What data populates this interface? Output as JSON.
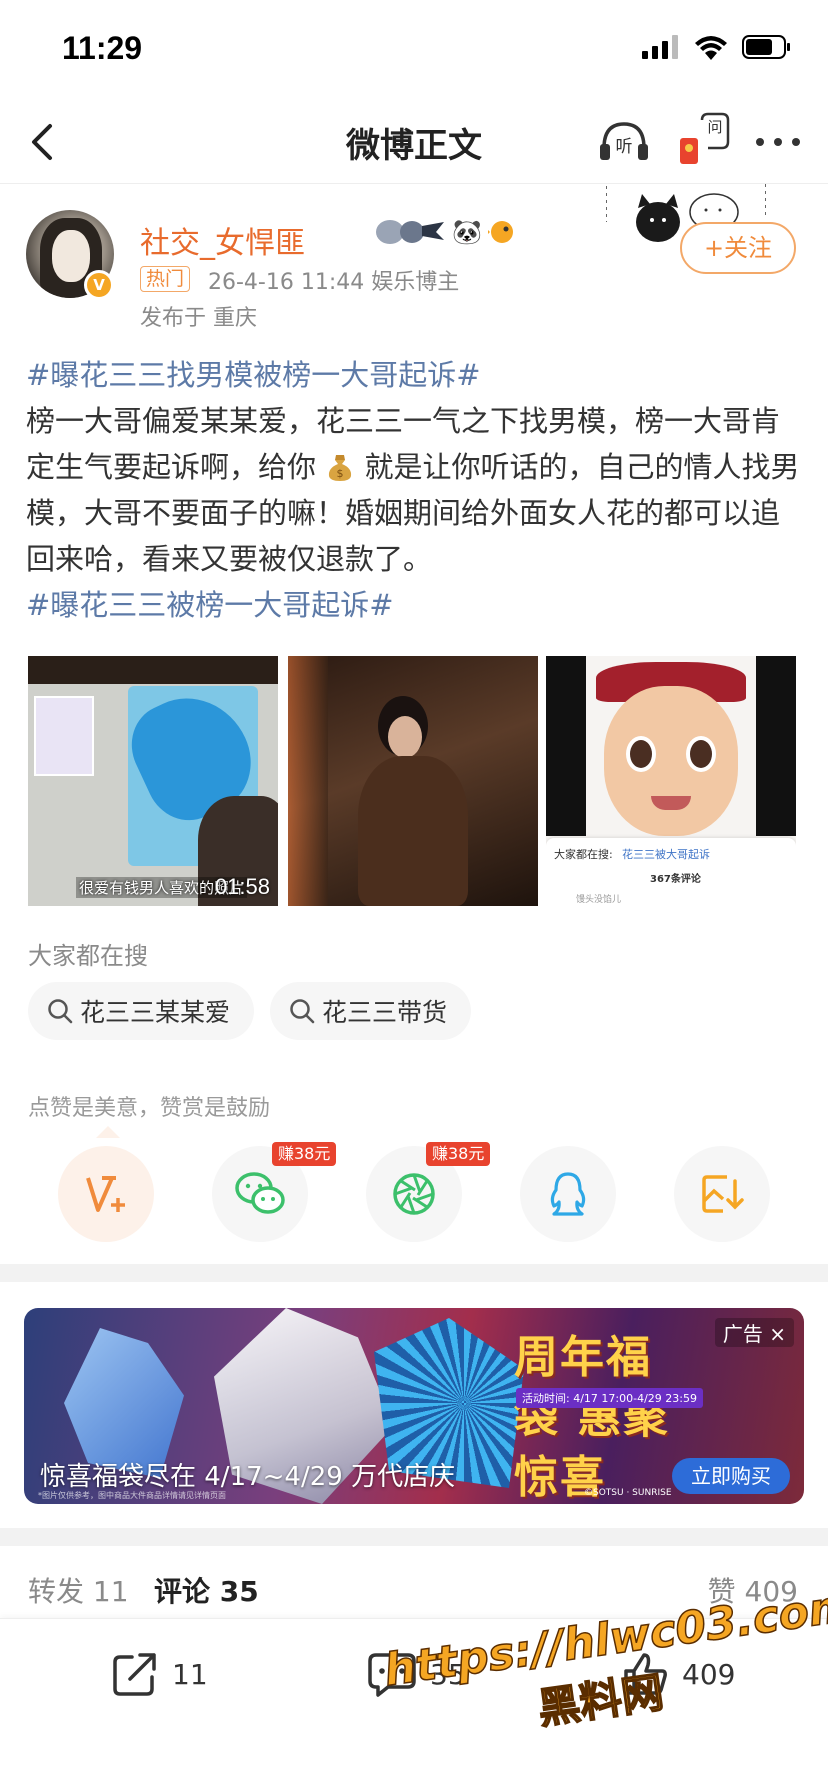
{
  "status_bar": {
    "time": "11:29"
  },
  "nav": {
    "title": "微博正文"
  },
  "author": {
    "name": "社交_女悍匪",
    "badge_emojis": "🐼",
    "hot_tag": "热门",
    "meta": "26-4-16 11:44  娱乐博主",
    "location": "发布于 重庆",
    "follow_label": "+关注"
  },
  "post": {
    "hashtag1": "#曝花三三找男模被榜一大哥起诉#",
    "body_part1": "榜一大哥偏爱某某爱，花三三一气之下找男模，榜一大哥肯定生气要起诉啊，给你",
    "body_part2": "就是让你听话的，自己的情人找男模，大哥不要面子的嘛！婚姻期间给外面女人花的都可以追回来哈，看来又要被仅退款了。",
    "hashtag2": "#曝花三三被榜一大哥起诉#"
  },
  "media": {
    "video_duration": "01:58",
    "video_caption": "很爱有钱男人喜欢的照片",
    "img3_search_label": "大家都在搜:",
    "img3_search_term": "花三三被大哥起诉",
    "img3_comment_count": "367条评论",
    "img3_user": "馒头没馅儿"
  },
  "search": {
    "label": "大家都在搜",
    "chips": [
      "花三三某某爱",
      "花三三带货"
    ]
  },
  "reward": {
    "label": "点赞是美意，赞赏是鼓励",
    "earn1": "赚38元",
    "earn2": "赚38元"
  },
  "ad": {
    "tag": "广告 ×",
    "headline": "周年福袋 惠聚惊喜",
    "event_time": "活动时间: 4/17 17:00-4/29 23:59",
    "text": "惊喜福袋尽在 4/17~4/29 万代店庆",
    "buy_label": "立即购买",
    "copyright": "©SOTSU · SUNRISE",
    "fine_print": "*图片仅供参考，图中商品大件商品详情请见详情页面"
  },
  "tabs": {
    "repost": "转发 11",
    "comment": "评论 35",
    "like": "赞 409"
  },
  "bottom_bar": {
    "repost_count": "11",
    "comment_count": "35",
    "like_count": "409"
  },
  "watermark": {
    "url": "https://hlwc03.com",
    "name": "黑料网"
  },
  "colors": {
    "accent_orange": "#f08b3c",
    "hashtag_blue": "#5d7aa7",
    "earn_red": "#e8432e",
    "wechat_green": "#3cc06b",
    "qq_blue": "#2ea8e6"
  }
}
